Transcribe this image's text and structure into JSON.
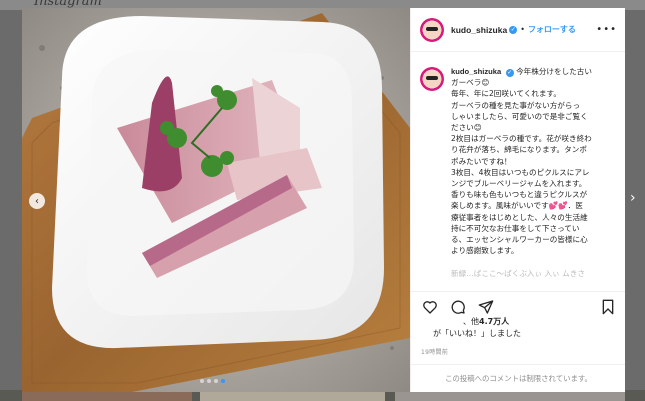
{
  "app": {
    "logo_text": "Instagram"
  },
  "post": {
    "username": "kudo_shizuka",
    "separator": "•",
    "follow_label": "フォローする",
    "more_icon": "more-horizontal-icon",
    "verified_icon": "verified-check-icon",
    "caption_lines": [
      "今年株分けをした古い",
      "ガーベラ😊",
      "毎年、年に2回咲いてくれます。",
      "ガーベラの種を見た事がない方がらっ",
      "しゃいましたら、可愛いので是非ご覧く",
      "ださい😊",
      "2枚目はガーベラの種です。花が咲き終わ",
      "り花弁が落ち、綿毛になります。タンポ",
      "ポみたいですね！",
      "3枚目、4枚目はいつものピクルスにアレ",
      "ンジでブルーベリージャムを入れます。",
      "香りも味も色もいつもと違うピクルスが",
      "楽しめます。風味がいいです💕💕．医",
      "療従事者をはじめとした、人々の生活維",
      "持に不可欠なお仕事をして下さってい",
      "る、エッセンシャルワーカーの皆様に心",
      "より感謝致します。",
      "",
      "新緑…ばここ〜ばくぶ入ぃ 入ぃ ムきさ"
    ],
    "actions": [
      "heart-icon",
      "comment-icon",
      "share-icon",
      "bookmark-icon"
    ],
    "likes_prefix": "、他",
    "likes_count": "4.7万人",
    "likes_suffix": "が「いいね！」しました",
    "time_ago": "19時間前",
    "comments_disabled": "この投稿へのコメントは制限されています。",
    "carousel_total": 4,
    "carousel_index": 3,
    "prev_icon": "chevron-left-icon",
    "next_icon": "chevron-right-icon"
  },
  "colors": {
    "accent": "#3897f0",
    "text": "#262626",
    "muted": "#8e8e8e",
    "border": "#efefef"
  }
}
